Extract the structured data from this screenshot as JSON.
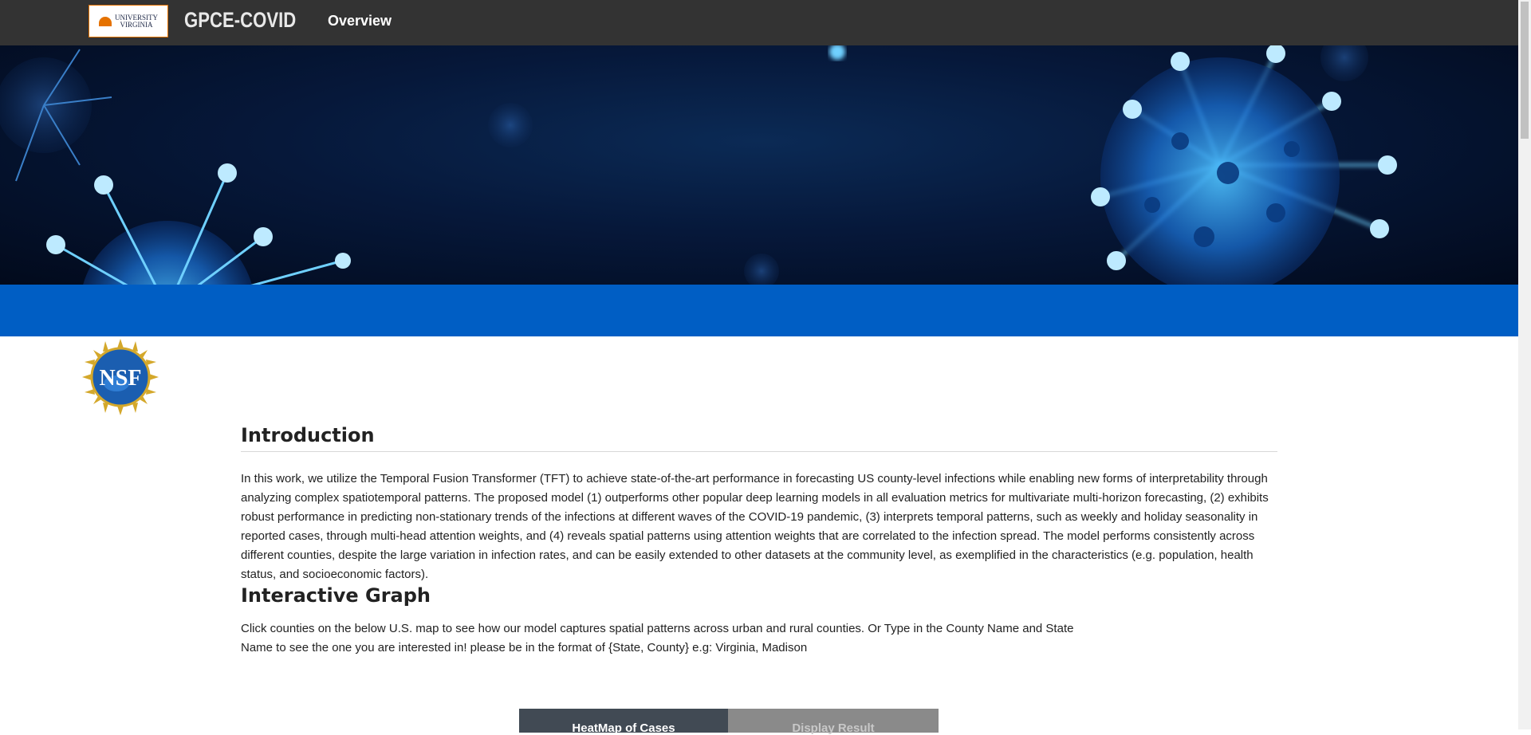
{
  "navbar": {
    "logo_text_line1": "UNIVERSITY",
    "logo_text_line2": "VIRGINIA",
    "brand": "GPCE-COVID",
    "links": [
      {
        "label": "Overview"
      }
    ]
  },
  "nsf_logo": {
    "text": "NSF"
  },
  "introduction": {
    "title": "Introduction",
    "body": "In this work, we utilize the Temporal Fusion Transformer (TFT) to achieve state-of-the-art performance in forecasting US county-level infections while enabling new forms of interpretability through analyzing complex spatiotemporal patterns. The proposed model (1) outperforms other popular deep learning models in all evaluation metrics for multivariate multi-horizon forecasting, (2) exhibits robust performance in predicting non-stationary trends of the infections at different waves of the COVID-19 pandemic, (3) interprets temporal patterns, such as weekly and holiday seasonality in reported cases, through multi-head attention weights, and (4) reveals spatial patterns using attention weights that are correlated to the infection spread. The model performs consistently across different counties, despite the large variation in infection rates, and can be easily extended to other datasets at the community level, as exemplified in the characteristics (e.g. population, health status, and socioeconomic factors)."
  },
  "interactive_graph": {
    "title": "Interactive Graph",
    "line1": "Click counties on the below U.S. map to see how our model captures spatial patterns across urban and rural counties. Or Type in the County Name and State",
    "line2": "Name to see the one you are interested in! please be in the format of {State, County} e.g: Virginia, Madison",
    "tabs": [
      {
        "label": "HeatMap of Cases"
      },
      {
        "label": "Display Result"
      }
    ]
  },
  "colors": {
    "navbar": "#333333",
    "accent_band": "#005ec4",
    "hero_dark": "#06183a",
    "virus_glow": "#1fa3ff"
  },
  "icons": [
    "university-logo-icon",
    "nsf-logo-icon",
    "virus-icon"
  ]
}
